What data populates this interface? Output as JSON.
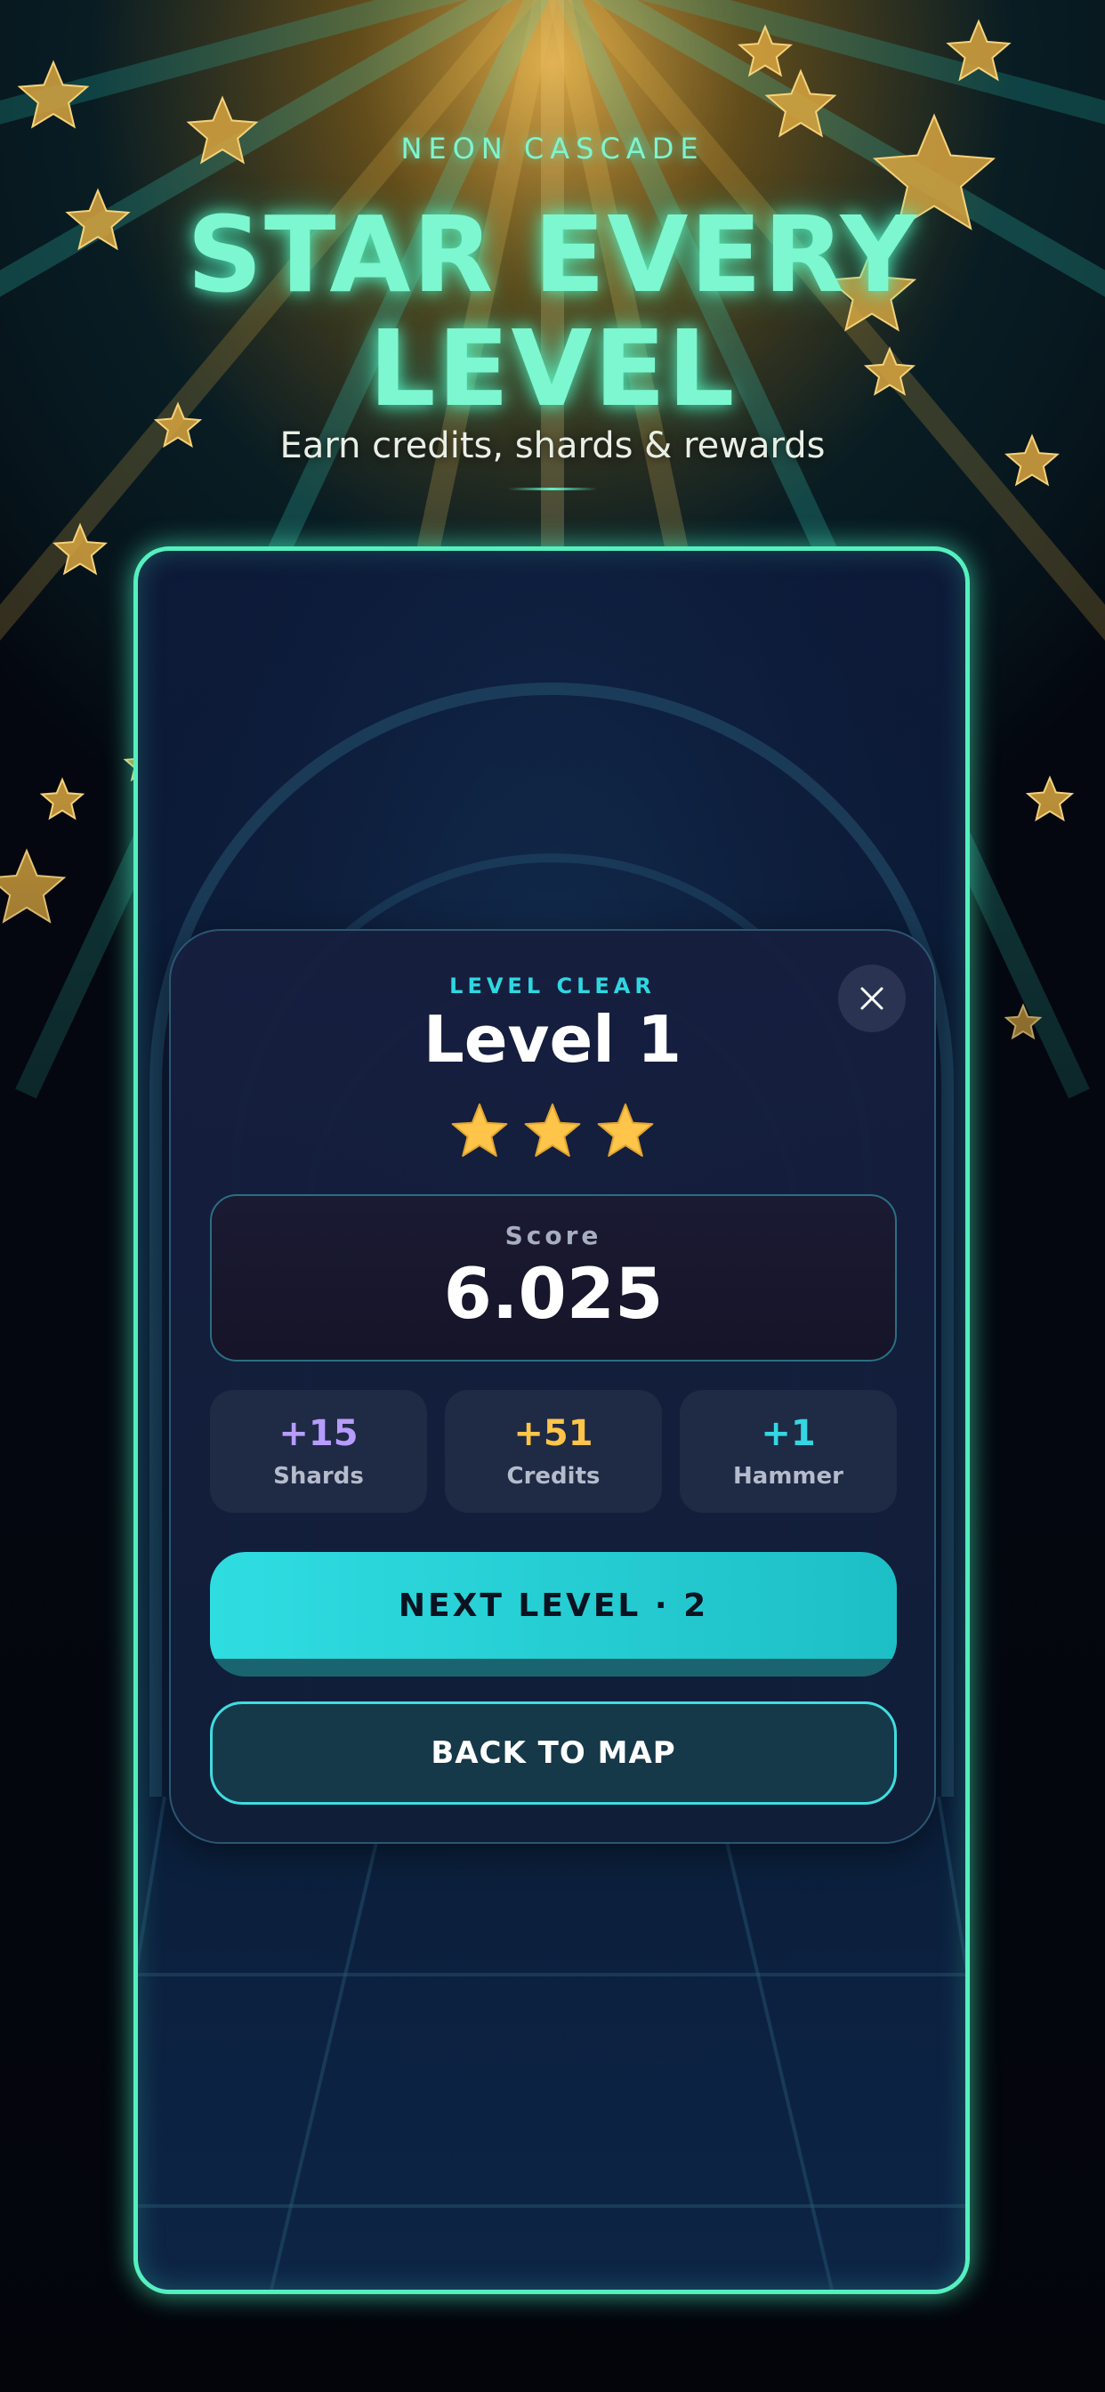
{
  "header": {
    "brand": "NEON CASCADE",
    "headline_line1": "STAR EVERY",
    "headline_line2": "LEVEL",
    "tagline": "Earn credits, shards & rewards"
  },
  "modal": {
    "eyebrow": "LEVEL CLEAR",
    "title": "Level 1",
    "stars_earned": 3,
    "stars_total": 3,
    "score_label": "Score",
    "score_value": "6.025",
    "rewards": [
      {
        "value": "+15",
        "label": "Shards",
        "color": "#b79cff"
      },
      {
        "value": "+51",
        "label": "Credits",
        "color": "#ffc44a"
      },
      {
        "value": "+1",
        "label": "Hammer",
        "color": "#33d6e2"
      }
    ],
    "next_button": "NEXT LEVEL · 2",
    "back_button": "BACK TO MAP",
    "close_icon": "close-icon"
  },
  "colors": {
    "accent_teal": "#55f0bf",
    "button_cyan": "#2fdde1",
    "star_gold": "#ffc44a",
    "modal_bg": "#161e3e"
  }
}
